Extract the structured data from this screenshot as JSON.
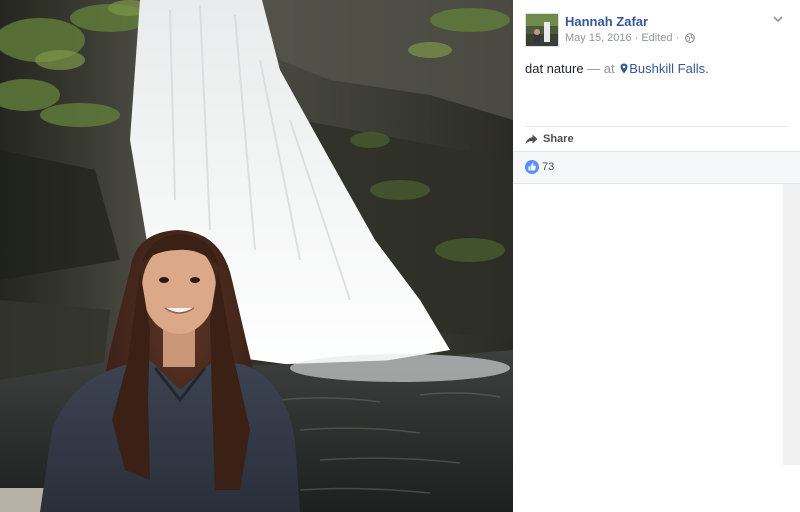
{
  "post": {
    "author": "Hannah Zafar",
    "date": "May 15, 2016",
    "separator": "·",
    "edited": "Edited",
    "audience_icon": "globe-icon",
    "text": "dat nature",
    "at_text": "— at",
    "location": "Bushkill Falls."
  },
  "actions": {
    "share_label": "Share",
    "share_icon": "share-arrow-icon"
  },
  "reactions": {
    "icon": "thumbs-up-icon",
    "like_count": "73"
  },
  "colors": {
    "link": "#365899",
    "meta": "#90949c",
    "body_text": "#1d2129",
    "like_blue": "#5890ff",
    "bar_bg": "#f6f7f9"
  }
}
